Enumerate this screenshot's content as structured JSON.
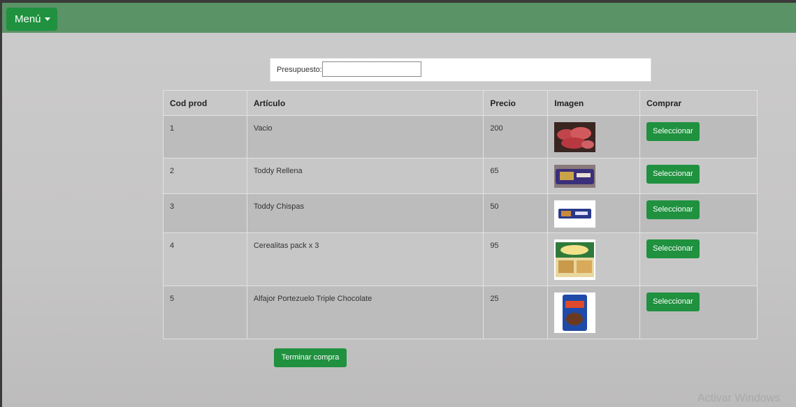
{
  "navbar": {
    "menu_label": "Menú"
  },
  "budget": {
    "label": "Presupuesto:",
    "value": ""
  },
  "table": {
    "headers": [
      "Cod prod",
      "Artículo",
      "Precio",
      "Imagen",
      "Comprar"
    ],
    "rows": [
      {
        "cod": "1",
        "articulo": "Vacio",
        "precio": "200",
        "button": "Seleccionar",
        "image": "meat-image"
      },
      {
        "cod": "2",
        "articulo": "Toddy Rellena",
        "precio": "65",
        "button": "Seleccionar",
        "image": "cookie-pack-image"
      },
      {
        "cod": "3",
        "articulo": "Toddy Chispas",
        "precio": "50",
        "button": "Seleccionar",
        "image": "cookie-pack-image"
      },
      {
        "cod": "4",
        "articulo": "Cerealitas pack x 3",
        "precio": "95",
        "button": "Seleccionar",
        "image": "cracker-box-image"
      },
      {
        "cod": "5",
        "articulo": "Alfajor Portezuelo Triple Chocolate",
        "precio": "25",
        "button": "Seleccionar",
        "image": "alfajor-image"
      }
    ]
  },
  "finish_button": "Terminar compra",
  "watermark": "Activar Windows",
  "colors": {
    "navbar": "#5a9366",
    "button": "#1f913f"
  }
}
